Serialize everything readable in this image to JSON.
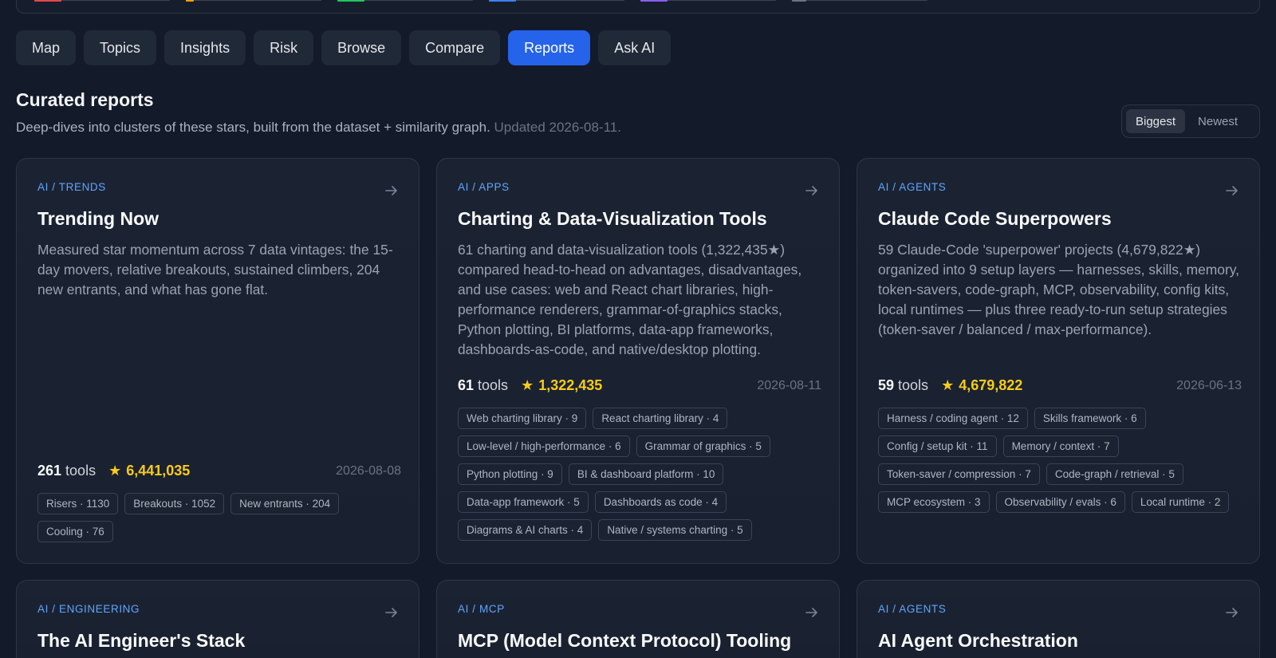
{
  "nav": {
    "tabs": [
      {
        "label": "Map"
      },
      {
        "label": "Topics"
      },
      {
        "label": "Insights"
      },
      {
        "label": "Risk"
      },
      {
        "label": "Browse"
      },
      {
        "label": "Compare"
      },
      {
        "label": "Reports"
      },
      {
        "label": "Ask AI"
      }
    ],
    "active": "Reports"
  },
  "top_strip_colors": [
    "#e5484d",
    "#f59e0b",
    "#22c55e",
    "#3b82f6",
    "#8b5cf6",
    "#6b7280"
  ],
  "header": {
    "title": "Curated reports",
    "subtitle": "Deep-dives into clusters of these stars, built from the dataset + similarity graph.",
    "updated": "Updated 2026-08-11."
  },
  "sort": {
    "options": [
      "Biggest",
      "Newest"
    ],
    "selected": "Biggest"
  },
  "tools_label": "tools",
  "cards": [
    {
      "category": "AI / TRENDS",
      "title": "Trending Now",
      "description": "Measured star momentum across 7 data vintages: the 15-day movers, relative breakouts, sustained climbers, 204 new entrants, and what has gone flat.",
      "tools": "261",
      "stars": "6,441,035",
      "date": "2026-08-08",
      "chips": [
        "Risers · 1130",
        "Breakouts · 1052",
        "New entrants · 204",
        "Cooling · 76"
      ]
    },
    {
      "category": "AI / APPS",
      "title": "Charting & Data-Visualization Tools",
      "description": "61 charting and data-visualization tools (1,322,435★) compared head-to-head on advantages, disadvantages, and use cases: web and React chart libraries, high-performance renderers, grammar-of-graphics stacks, Python plotting, BI platforms, data-app frameworks, dashboards-as-code, and native/desktop plotting.",
      "tools": "61",
      "stars": "1,322,435",
      "date": "2026-08-11",
      "chips": [
        "Web charting library · 9",
        "React charting library · 4",
        "Low-level / high-performance · 6",
        "Grammar of graphics · 5",
        "Python plotting · 9",
        "BI & dashboard platform · 10",
        "Data-app framework · 5",
        "Dashboards as code · 4",
        "Diagrams & AI charts · 4",
        "Native / systems charting · 5"
      ]
    },
    {
      "category": "AI / AGENTS",
      "title": "Claude Code Superpowers",
      "description": "59 Claude-Code 'superpower' projects (4,679,822★) organized into 9 setup layers — harnesses, skills, memory, token-savers, code-graph, MCP, observability, config kits, local runtimes — plus three ready-to-run setup strategies (token-saver / balanced / max-performance).",
      "tools": "59",
      "stars": "4,679,822",
      "date": "2026-06-13",
      "chips": [
        "Harness / coding agent · 12",
        "Skills framework · 6",
        "Config / setup kit · 11",
        "Memory / context · 7",
        "Token-saver / compression · 7",
        "Code-graph / retrieval · 5",
        "MCP ecosystem · 3",
        "Observability / evals · 6",
        "Local runtime · 2"
      ]
    },
    {
      "category": "AI / ENGINEERING",
      "title": "The AI Engineer's Stack"
    },
    {
      "category": "AI / MCP",
      "title": "MCP (Model Context Protocol) Tooling"
    },
    {
      "category": "AI / AGENTS",
      "title": "AI Agent Orchestration"
    }
  ]
}
